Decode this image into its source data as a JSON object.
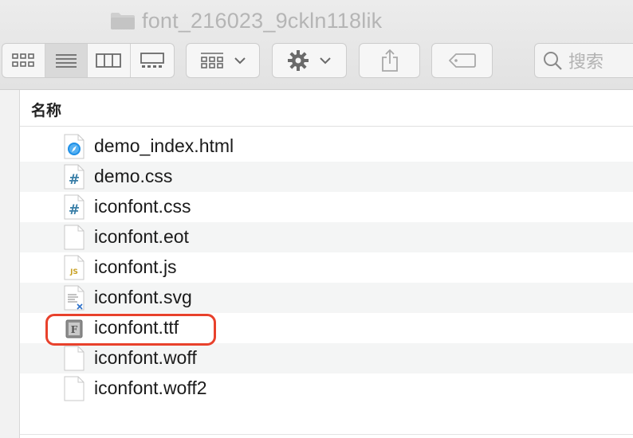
{
  "window": {
    "title": "font_216023_9ckln118lik"
  },
  "toolbar": {
    "view_modes": [
      {
        "name": "icon-view-button",
        "icon": "grid-icon"
      },
      {
        "name": "list-view-button",
        "icon": "list-icon",
        "active": true
      },
      {
        "name": "column-view-button",
        "icon": "columns-icon"
      },
      {
        "name": "gallery-view-button",
        "icon": "gallery-icon"
      }
    ],
    "group_button_icon": "group-icon",
    "action_button_icon": "gear-icon",
    "share_button_icon": "share-icon",
    "tag_button_icon": "tag-icon",
    "search_placeholder": "搜索"
  },
  "columns": {
    "name_header": "名称"
  },
  "files": [
    {
      "name": "demo_index.html",
      "icon": "safari-html-icon"
    },
    {
      "name": "demo.css",
      "icon": "css-hash-icon"
    },
    {
      "name": "iconfont.css",
      "icon": "css-hash-icon"
    },
    {
      "name": "iconfont.eot",
      "icon": "blank-document-icon"
    },
    {
      "name": "iconfont.js",
      "icon": "js-document-icon"
    },
    {
      "name": "iconfont.svg",
      "icon": "svg-document-icon"
    },
    {
      "name": "iconfont.ttf",
      "icon": "font-file-icon",
      "highlighted": true
    },
    {
      "name": "iconfont.woff",
      "icon": "blank-document-icon"
    },
    {
      "name": "iconfont.woff2",
      "icon": "blank-document-icon"
    }
  ],
  "colors": {
    "highlight": "#e8412c",
    "css_icon": "#3a7fa8",
    "js_icon": "#c9a227",
    "safari_icon": "#1e8fe6"
  }
}
